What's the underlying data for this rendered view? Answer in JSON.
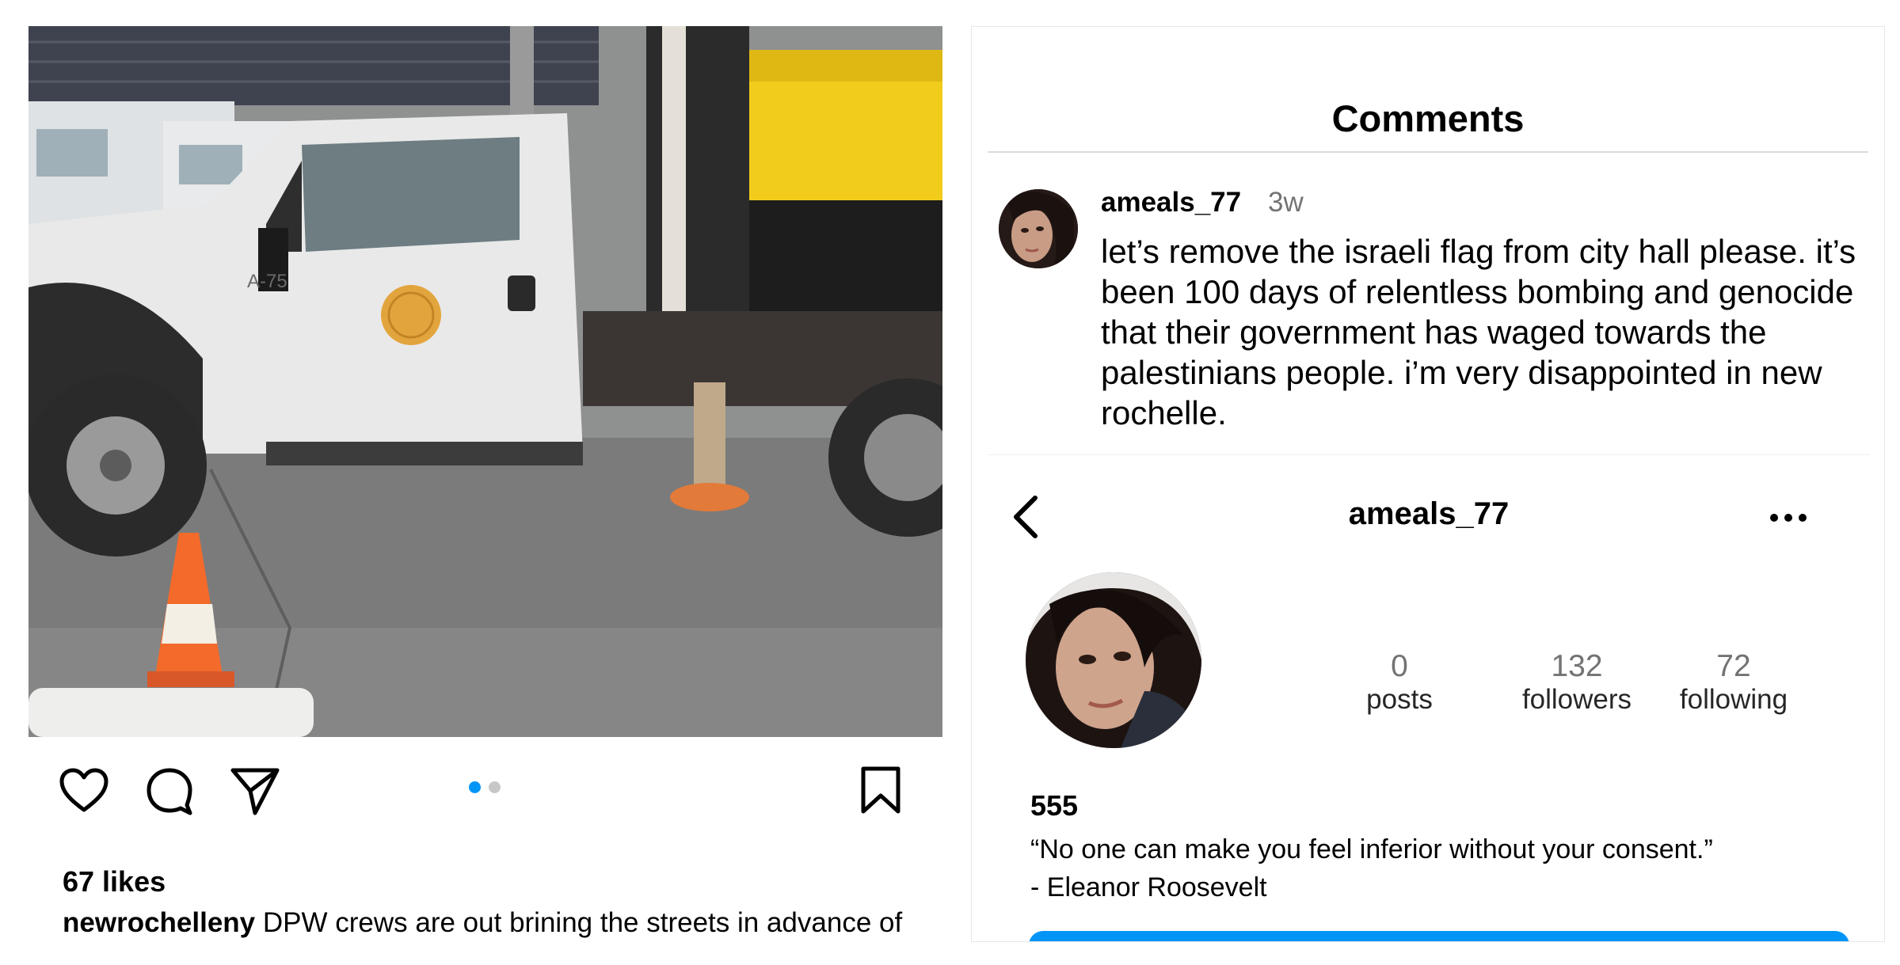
{
  "post": {
    "likes": "67 likes",
    "username": "newrochelleny",
    "caption": "DPW crews are out brining the streets in advance of the snow predicted for late tonight and tomorrow",
    "carousel_count": 2,
    "carousel_active": 1,
    "photo_label_truck": "A-75",
    "icons": [
      "heart-icon",
      "comment-icon",
      "share-icon",
      "bookmark-icon"
    ]
  },
  "comments": {
    "title": "Comments",
    "items": [
      {
        "username": "ameals_77",
        "time": "3w",
        "text": "let’s remove the israeli flag from city hall please. it’s been 100 days of relentless bombing and genocide that their government has waged towards the palestinians people. i’m very disappointed in new rochelle."
      }
    ]
  },
  "profile": {
    "handle": "ameals_77",
    "stats": {
      "posts": "0",
      "posts_label": "posts",
      "followers": "132",
      "followers_label": "followers",
      "following": "72",
      "following_label": "following"
    },
    "name": "555",
    "bio_line1": "“No one can make you feel inferior without your consent.”",
    "bio_line2": "- Eleanor Roosevelt",
    "accent_color": "#0095f6"
  }
}
